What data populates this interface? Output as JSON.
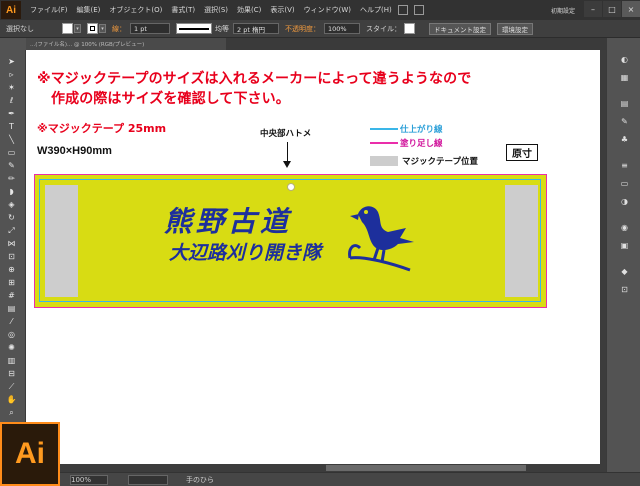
{
  "app": {
    "logo": "Ai"
  },
  "menubar": {
    "items": [
      "ファイル(F)",
      "編集(E)",
      "オブジェクト(O)",
      "書式(T)",
      "選択(S)",
      "効果(C)",
      "表示(V)",
      "ウィンドウ(W)",
      "ヘルプ(H)"
    ],
    "workspace": "初期設定",
    "window_buttons": [
      "–",
      "□",
      "×"
    ]
  },
  "controlbar": {
    "selection": "選択なし",
    "stroke_label": "線：",
    "stroke_weight": "1 pt",
    "profile": "均等",
    "brush": "2 pt 楕円",
    "opacity_label": "不透明度：",
    "opacity": "100%",
    "style_label": "スタイル：",
    "doc_settings": "ドキュメント設定",
    "env_settings": "環境設定"
  },
  "document_tab": "...(ファイル名)... @ 100% (RGB/プレビュー)",
  "artboard": {
    "note_line1": "※マジックテープのサイズは入れるメーカーによって違うようなので",
    "note_line2": "作成の際はサイズを確認して下さい。",
    "spec_tape": "※マジックテープ 25mm",
    "spec_size": "W390×H90mm",
    "center_label": "中央部ハトメ",
    "legend": {
      "trim": "仕上がり線",
      "bleed": "塗り足し線",
      "tape": "マジックテープ位置"
    },
    "actual_size": "原寸",
    "banner_title": "熊野古道",
    "banner_subtitle": "大辺路刈り開き隊"
  },
  "colors": {
    "note_red": "#e8001c",
    "tape_yellow": "#d8dc13",
    "ink_blue": "#1d2f9c",
    "trim_cyan": "#3ab6e8",
    "bleed_magenta": "#ea2eaa",
    "ai_orange": "#ff9a1f"
  },
  "statusbar": {
    "zoom": "100%",
    "tool": "手のひら"
  }
}
